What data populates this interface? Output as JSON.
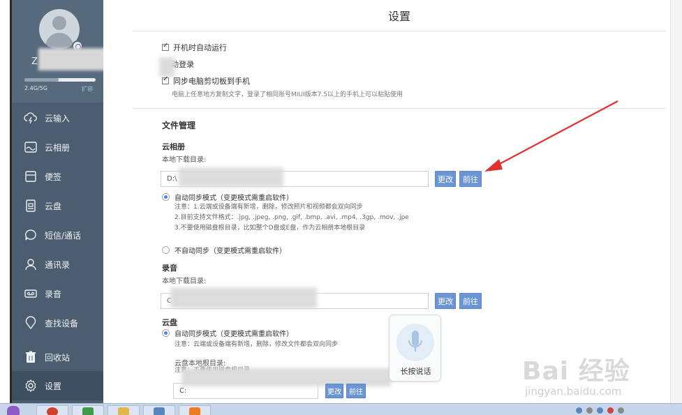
{
  "sidebar": {
    "username": "Z",
    "storage": {
      "label": "2.4G/5G",
      "used_fraction": 0.48,
      "expand_label": "扩容"
    },
    "items": [
      {
        "label": "云输入",
        "icon": "cloud-input-icon"
      },
      {
        "label": "云相册",
        "icon": "photo-album-icon"
      },
      {
        "label": "便签",
        "icon": "note-icon"
      },
      {
        "label": "云盘",
        "icon": "cloud-disk-icon"
      },
      {
        "label": "短信/通话",
        "icon": "chat-call-icon"
      },
      {
        "label": "通讯录",
        "icon": "contacts-icon"
      },
      {
        "label": "录音",
        "icon": "recorder-icon"
      },
      {
        "label": "查找设备",
        "icon": "find-device-icon"
      },
      {
        "label": "回收站",
        "icon": "trash-icon"
      },
      {
        "label": "设置",
        "icon": "gear-icon",
        "active": true
      }
    ]
  },
  "main": {
    "title": "设置",
    "general": {
      "autostart": {
        "label": "开机时自动运行",
        "checked": true
      },
      "autologin": {
        "label": "动登录",
        "checked": false
      },
      "clipboard": {
        "label": "同步电脑剪切板到手机",
        "checked": true,
        "hint": "电脑上任意地方复制文字，登录了相同账号MIUI版本7.5以上的手机上可以粘贴使用"
      }
    },
    "file_management": {
      "title": "文件管理",
      "album": {
        "title": "云相册",
        "dir_label": "本地下载目录:",
        "path": "D:\\",
        "change_label": "更改",
        "goto_label": "前往",
        "auto_sync": {
          "label": "自动同步模式（变更模式需重启软件）",
          "selected": true,
          "notes": [
            "注意：1.云端或设备端有新增，删除，修改照片和视频都会双向同步",
            "2.目前支持文件格式：.jpg, .jpeg, .png, .gif, .bmp, .avi, .mp4, .3gp, .mov, .jpe",
            "3.不要使用磁盘根目录，比如整个D盘或E盘，作为云相册本地根目录"
          ]
        },
        "no_sync": {
          "label": "不自动同步（变更模式需重启软件）",
          "selected": false
        }
      },
      "recording": {
        "title": "录音",
        "dir_label": "本地下载目录:",
        "path": "C",
        "change_label": "更改",
        "goto_label": "前往"
      },
      "disk": {
        "title": "云盘",
        "auto_sync": {
          "label": "自动同步模式（变更模式需重启软件）",
          "selected": true,
          "note": "注意：云端或设备端有新增，删除，修改文件都会双向同步"
        },
        "root_label": "云盘本地根目录:",
        "root_note": "注意：不要使用磁盘根目录",
        "path": "C:",
        "change_label": "更改",
        "goto_label": "前往"
      }
    }
  },
  "voice_popup": {
    "label": "长按说话",
    "icon": "microphone-icon"
  },
  "watermark": {
    "main": "Bai 经验",
    "sub": "jingyan.baidu.com"
  },
  "colors": {
    "sidebar": "#4b5d6e",
    "button": "#6b95d3",
    "arrow": "#e03030",
    "radio_on": "#4a86d6"
  }
}
